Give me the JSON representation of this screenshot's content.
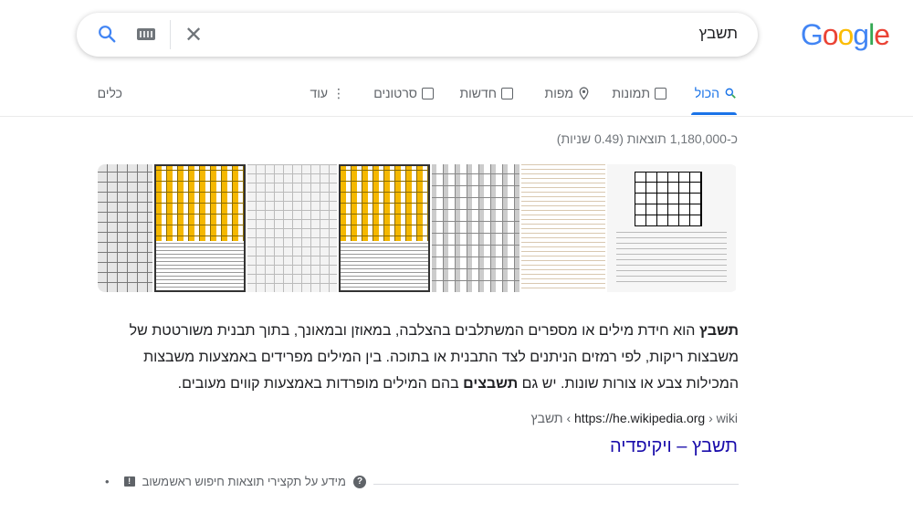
{
  "logo": {
    "letters": [
      "G",
      "o",
      "o",
      "g",
      "l",
      "e"
    ],
    "colors": [
      "#4285f4",
      "#ea4335",
      "#fbbc05",
      "#4285f4",
      "#34a853",
      "#ea4335"
    ]
  },
  "search": {
    "query": "תשבץ",
    "clear_icon": "close-icon",
    "keyboard_icon": "keyboard-icon",
    "search_icon": "search-icon"
  },
  "tabs": {
    "all": "הכול",
    "images": "תמונות",
    "maps": "מפות",
    "news": "חדשות",
    "videos": "סרטונים",
    "more": "עוד",
    "tools": "כלים"
  },
  "stats": "כ-1,180,000 תוצאות (0.49 שניות)",
  "snippet": {
    "term": "תשבץ",
    "part1": " הוא חידת מילים או מספרים המשתלבים בהצלבה, במאוזן ובמאונך, בתוך תבנית משורטטת של משבצות ריקות, לפי רמזים הניתנים לצד התבנית או בתוכה. בין המילים מפרידים באמצעות משבצות המכילות צבע או צורות שונות. יש גם ",
    "term_plural": "תשבצים",
    "part2": " בהם המילים מופרדות באמצעות קווים מעובים."
  },
  "cite": {
    "url": "https://he.wikipedia.org",
    "path": " › wiki › תשבץ"
  },
  "result_title": "תשבץ – ויקיפדיה",
  "about": {
    "label": "מידע על תקצירי תוצאות חיפוש ראשונות",
    "separator": "•",
    "feedback": "משוב"
  },
  "accent": "#1a73e8",
  "link_color": "#1a0dab"
}
